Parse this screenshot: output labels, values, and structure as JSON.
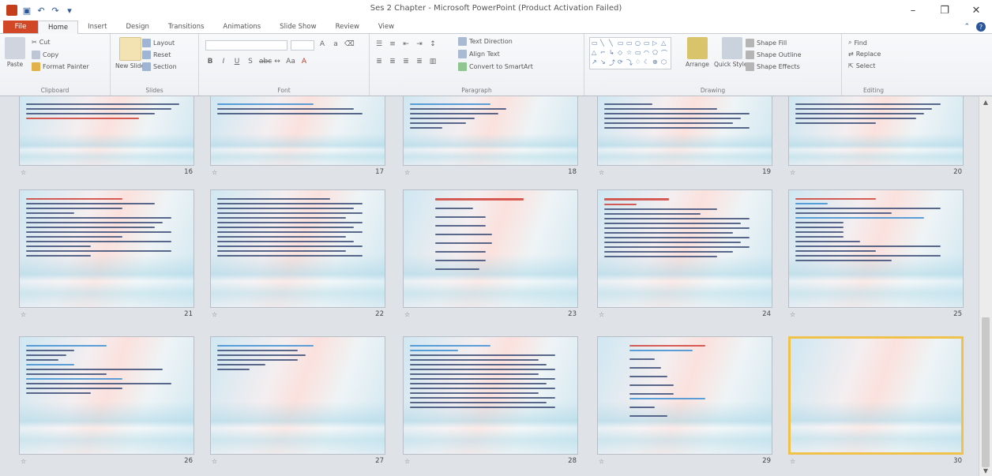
{
  "titlebar": {
    "title": "Ses 2 Chapter - Microsoft PowerPoint (Product Activation Failed)",
    "minimize": "–",
    "maximize": "❐",
    "close": "✕"
  },
  "ribbon_tabs": {
    "file": "File",
    "tabs": [
      "Home",
      "Insert",
      "Design",
      "Transitions",
      "Animations",
      "Slide Show",
      "Review",
      "View"
    ]
  },
  "ribbon": {
    "clipboard": {
      "paste": "Paste",
      "cut": "Cut",
      "copy": "Copy",
      "format_painter": "Format Painter",
      "label": "Clipboard"
    },
    "slides": {
      "new_slide": "New Slide",
      "layout": "Layout",
      "reset": "Reset",
      "section": "Section",
      "label": "Slides"
    },
    "font": {
      "label": "Font"
    },
    "paragraph": {
      "text_direction": "Text Direction",
      "align_text": "Align Text",
      "smartart": "Convert to SmartArt",
      "label": "Paragraph"
    },
    "drawing": {
      "arrange": "Arrange",
      "quick_styles": "Quick Styles",
      "shape_fill": "Shape Fill",
      "shape_outline": "Shape Outline",
      "shape_effects": "Shape Effects",
      "label": "Drawing"
    },
    "editing": {
      "find": "Find",
      "replace": "Replace",
      "select": "Select",
      "label": "Editing"
    }
  },
  "slides": [
    {
      "number": "16"
    },
    {
      "number": "17"
    },
    {
      "number": "18"
    },
    {
      "number": "19"
    },
    {
      "number": "20"
    },
    {
      "number": "21"
    },
    {
      "number": "22"
    },
    {
      "number": "23"
    },
    {
      "number": "24"
    },
    {
      "number": "25"
    },
    {
      "number": "26"
    },
    {
      "number": "27"
    },
    {
      "number": "28"
    },
    {
      "number": "29"
    },
    {
      "number": "30"
    }
  ],
  "selected_slide": "30",
  "colors": {
    "file_tab": "#d24726",
    "selection_border": "#f0c24b",
    "text_dark": "#3d4f78",
    "text_red": "#d0413a",
    "text_blue": "#3f8fd2"
  }
}
